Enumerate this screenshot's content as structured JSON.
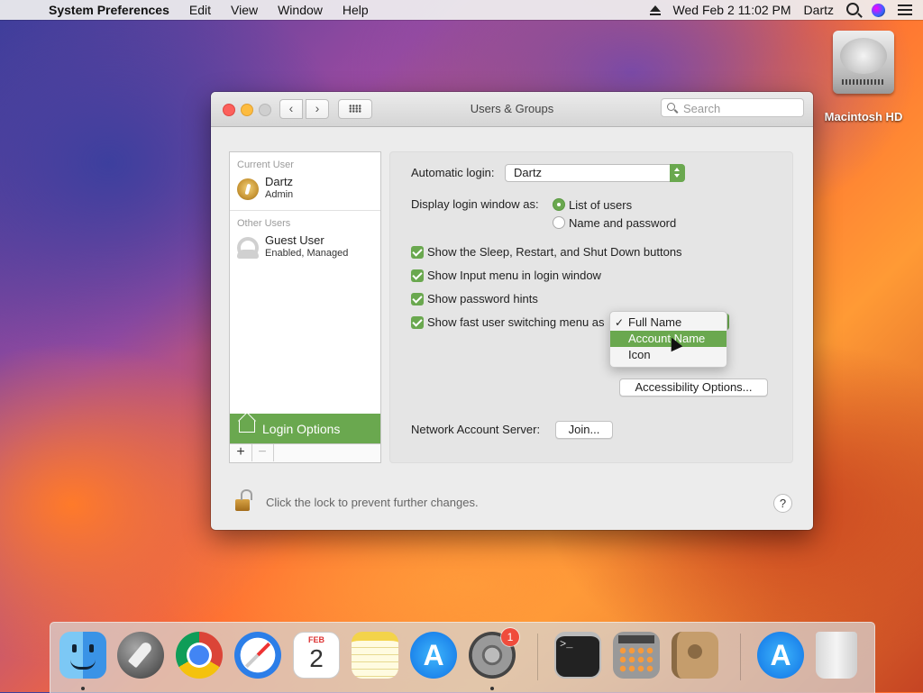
{
  "menubar": {
    "app_name": "System Preferences",
    "items": [
      "Edit",
      "View",
      "Window",
      "Help"
    ],
    "clock": "Wed Feb 2  11:02 PM",
    "user": "Dartz"
  },
  "desktop": {
    "drive_label": "Macintosh HD"
  },
  "window": {
    "title": "Users & Groups",
    "search_placeholder": "Search",
    "sidebar": {
      "current_user_header": "Current User",
      "current_user": {
        "name": "Dartz",
        "role": "Admin"
      },
      "other_users_header": "Other Users",
      "other_users": [
        {
          "name": "Guest User",
          "role": "Enabled, Managed"
        }
      ],
      "login_options_label": "Login Options",
      "add_label": "+",
      "remove_label": "−"
    },
    "pane": {
      "auto_login_label": "Automatic login:",
      "auto_login_value": "Dartz",
      "display_login_label": "Display login window as:",
      "display_options": [
        "List of users",
        "Name and password"
      ],
      "display_selected": "List of users",
      "checkboxes": [
        {
          "label": "Show the Sleep, Restart, and Shut Down buttons",
          "checked": true
        },
        {
          "label": "Show Input menu in login window",
          "checked": true
        },
        {
          "label": "Show password hints",
          "checked": true
        },
        {
          "label": "Show fast user switching menu as",
          "checked": true
        }
      ],
      "fast_switch_menu": {
        "options": [
          "Full Name",
          "Account Name",
          "Icon"
        ],
        "checked": "Full Name",
        "highlighted": "Account Name"
      },
      "accessibility_button": "Accessibility Options...",
      "network_server_label": "Network Account Server:",
      "join_button": "Join..."
    },
    "footer": {
      "lock_text": "Click the lock to prevent further changes.",
      "help_label": "?"
    }
  },
  "dock": {
    "calendar_month": "FEB",
    "calendar_day": "2",
    "prefs_badge": "1"
  },
  "colors": {
    "accent": "#6aa84f"
  }
}
